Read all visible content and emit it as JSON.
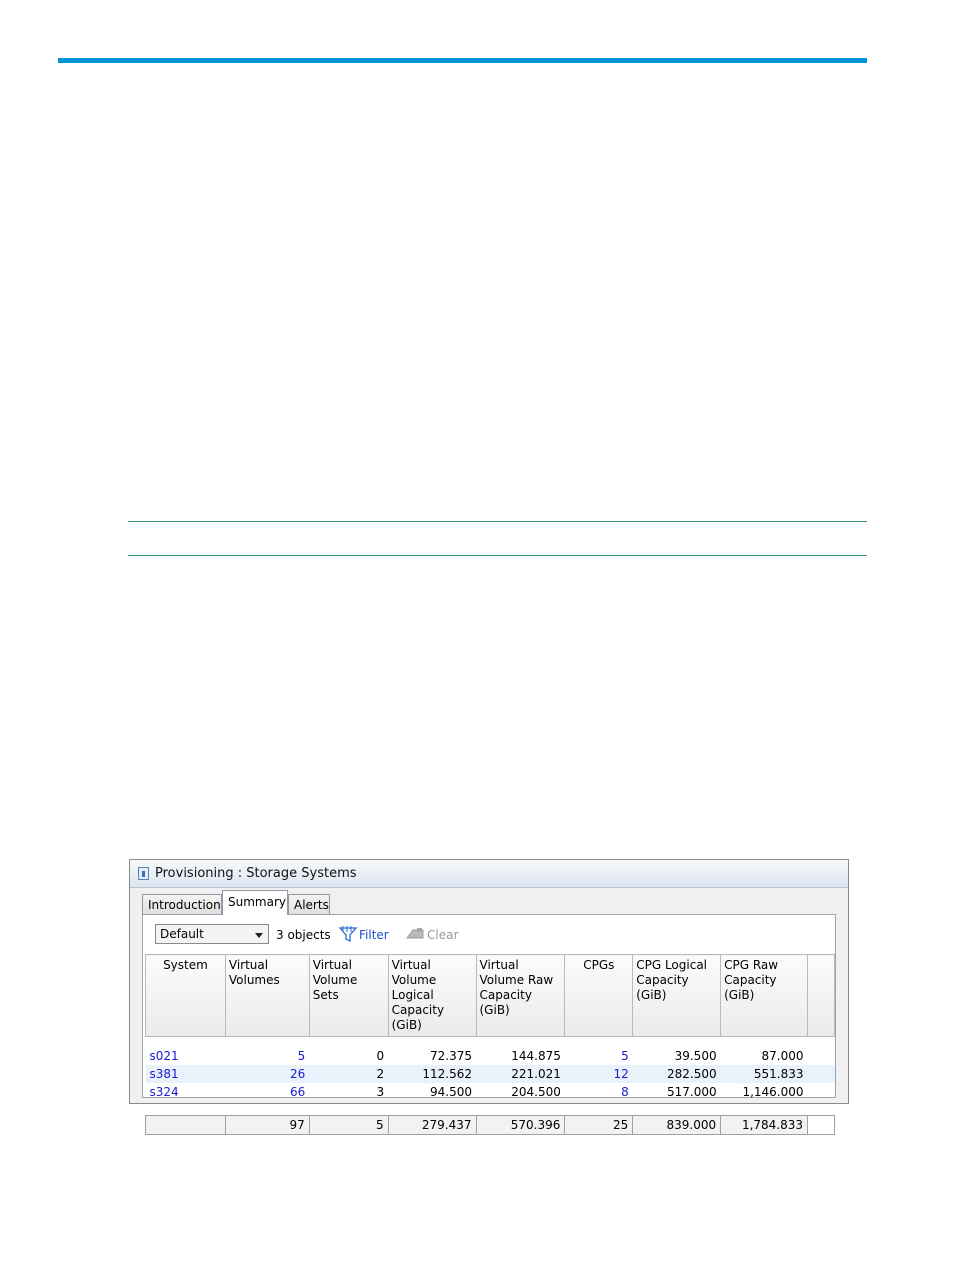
{
  "window": {
    "title": "Provisioning : Storage Systems"
  },
  "tabs": [
    {
      "label": "Introduction",
      "active": false
    },
    {
      "label": "Summary",
      "active": true
    },
    {
      "label": "Alerts",
      "active": false
    }
  ],
  "toolbar": {
    "view_selected": "Default",
    "object_count": "3 objects",
    "filter_label": "Filter",
    "clear_label": "Clear"
  },
  "table": {
    "headers": [
      "System",
      "Virtual Volumes",
      "Virtual Volume Sets",
      "Virtual Volume Logical Capacity (GiB)",
      "Virtual Volume Raw Capacity (GiB)",
      "CPGs",
      "CPG Logical Capacity (GiB)",
      "CPG Raw Capacity (GiB)"
    ],
    "rows": [
      [
        "s021",
        "5",
        "0",
        "72.375",
        "144.875",
        "5",
        "39.500",
        "87.000"
      ],
      [
        "s381",
        "26",
        "2",
        "112.562",
        "221.021",
        "12",
        "282.500",
        "551.833"
      ],
      [
        "s324",
        "66",
        "3",
        "94.500",
        "204.500",
        "8",
        "517.000",
        "1,146.000"
      ]
    ],
    "totals": [
      "",
      "97",
      "5",
      "279.437",
      "570.396",
      "25",
      "839.000",
      "1,784.833"
    ]
  },
  "colors": {
    "accent_rule": "#0096d6",
    "note_rule": "#2e8b7a",
    "link": "#1a1ad6"
  }
}
